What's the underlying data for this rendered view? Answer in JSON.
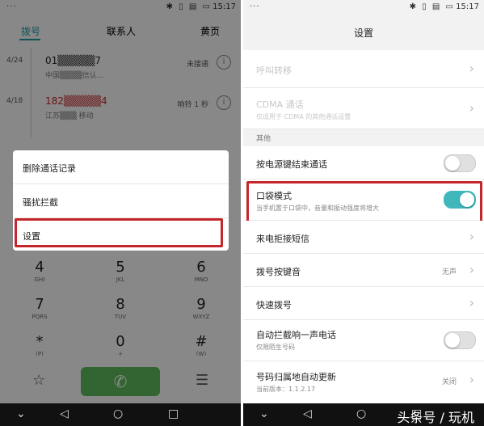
{
  "status": {
    "time": "15:17",
    "dots": "···"
  },
  "dialer": {
    "tabs": [
      "拨号",
      "联系人",
      "黄页"
    ],
    "calls": [
      {
        "date": "4/24",
        "number": "01▒▒▒▒▒7",
        "location": "中国▒▒▒▒信认...",
        "status": "未接通"
      },
      {
        "date": "4/18",
        "number": "182▒▒▒▒▒4",
        "location": "江苏▒▒▒ 移动",
        "status": "响铃 1 秒"
      }
    ],
    "menu": [
      "删除通话记录",
      "骚扰拦截",
      "设置"
    ],
    "keys": [
      {
        "digit": "4",
        "letters": "GHI"
      },
      {
        "digit": "5",
        "letters": "JKL"
      },
      {
        "digit": "6",
        "letters": "MNO"
      },
      {
        "digit": "7",
        "letters": "PQRS"
      },
      {
        "digit": "8",
        "letters": "TUV"
      },
      {
        "digit": "9",
        "letters": "WXYZ"
      },
      {
        "digit": "*",
        "letters": "(P)"
      },
      {
        "digit": "0",
        "letters": "+"
      },
      {
        "digit": "#",
        "letters": "(W)"
      }
    ]
  },
  "settings": {
    "title": "设置",
    "rows": [
      {
        "title": "呼叫转移"
      },
      {
        "title": "CDMA 通话",
        "sub": "仅适用于 CDMA 的其他通话设置"
      },
      {
        "section": "其他"
      },
      {
        "title": "按电源键结束通话",
        "toggle": "off"
      },
      {
        "title": "口袋模式",
        "sub": "当手机置于口袋中，音量和振动强度将增大",
        "toggle": "on"
      },
      {
        "title": "来电拒接短信"
      },
      {
        "title": "拨号按键音",
        "value": "无声"
      },
      {
        "title": "快速拨号"
      },
      {
        "title": "自动拦截响一声电话",
        "sub": "仅限陌生号码",
        "toggle": "off"
      },
      {
        "title": "号码归属地自动更新",
        "sub": "当前版本：1.1.2.17",
        "value": "关闭"
      }
    ]
  },
  "watermark": "头条号 / 玩机",
  "colors": {
    "accent": "#3fb7bb",
    "highlight": "#c3262b",
    "call": "#5cb85c"
  }
}
